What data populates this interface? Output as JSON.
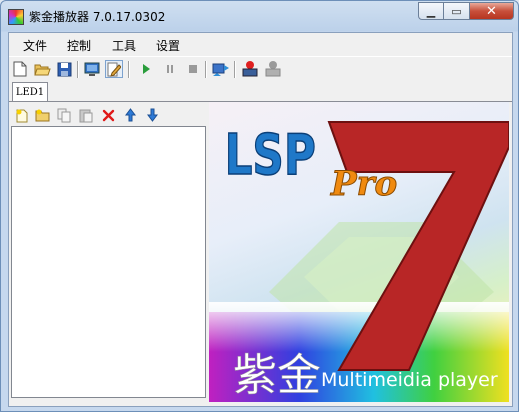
{
  "window": {
    "title": "紫金播放器 7.0.17.0302"
  },
  "menu": [
    {
      "label": "文件"
    },
    {
      "label": "控制"
    },
    {
      "label": "工具"
    },
    {
      "label": "设置"
    }
  ],
  "tabs": [
    {
      "label": "LED1"
    }
  ],
  "splash": {
    "logo_main": "LSP",
    "logo_sub": "Pro",
    "version_number": "7",
    "chinese_logo": "紫金",
    "tagline": "Multimeidia player"
  },
  "icons": {
    "toolbar": [
      "new-file-icon",
      "open-folder-icon",
      "save-icon",
      "display-icon",
      "edit-icon",
      "play-icon",
      "pause-icon",
      "stop-icon",
      "refresh-icon",
      "record-icon",
      "record-disabled-icon"
    ],
    "list_toolbar": [
      "new-item-icon",
      "new-folder-icon",
      "copy-icon",
      "paste-icon",
      "delete-icon",
      "move-up-icon",
      "move-down-icon"
    ]
  },
  "colors": {
    "accent": "#1f78c8",
    "logo_red": "#b82626",
    "pro_orange": "#f08a10"
  }
}
